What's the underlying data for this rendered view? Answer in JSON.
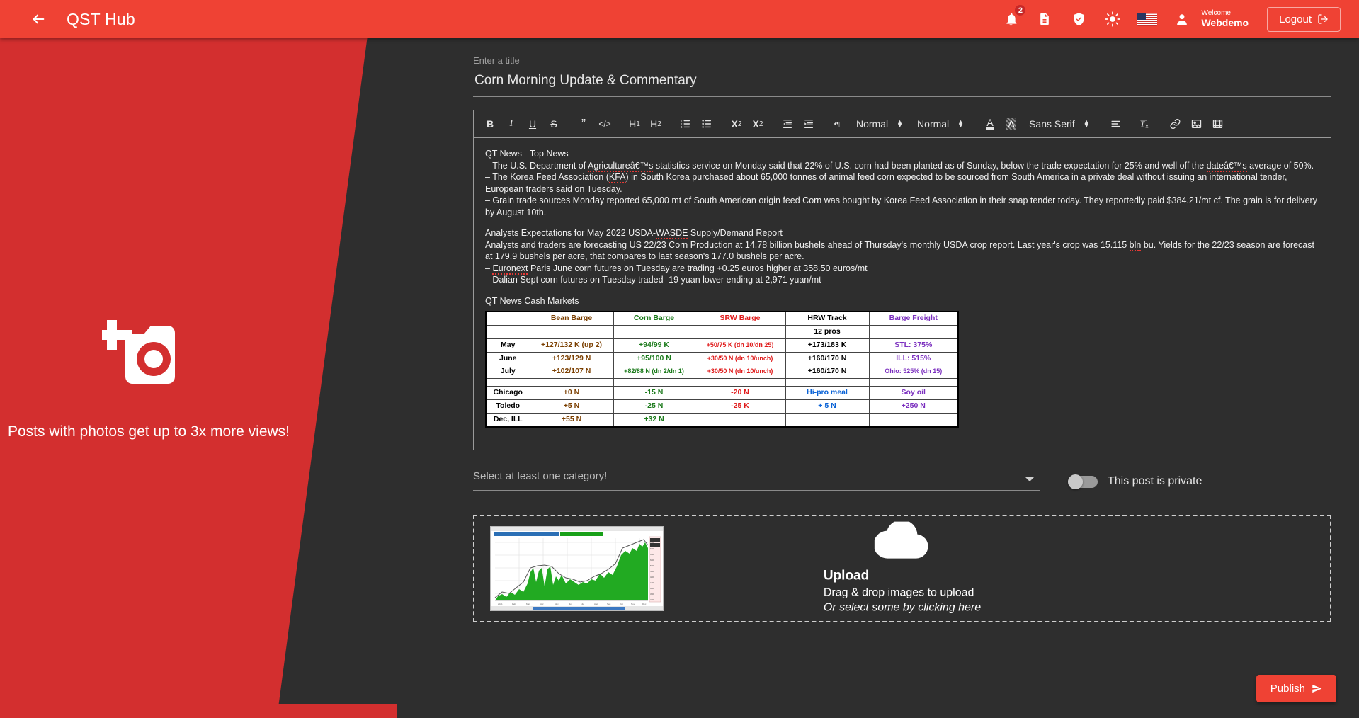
{
  "header": {
    "back_icon": "arrow-left-icon",
    "app_title": "QST Hub",
    "notifications_icon": "bell-icon",
    "notifications_count": "2",
    "documents_icon": "document-icon",
    "shield_icon": "shield-check-icon",
    "theme_icon": "sun-icon",
    "language_icon": "us-flag-icon",
    "avatar_icon": "person-icon",
    "welcome_label": "Welcome",
    "user_name": "Webdemo",
    "logout_label": "Logout",
    "logout_icon": "sign-out-icon",
    "accent_color": "#ef4234"
  },
  "promo": {
    "icon": "add-photo-icon",
    "text": "Posts with photos get up to 3x more views!",
    "background_color": "#d32f2f"
  },
  "compose": {
    "title_label": "Enter a title",
    "title_value": "Corn Morning Update & Commentary",
    "title_placeholder": "Enter a title"
  },
  "toolbar": {
    "bold": "B",
    "italic": "I",
    "underline": "U",
    "strike": "S",
    "blockquote": "”",
    "code_block": "</>",
    "header1": "H",
    "header1_sub": "1",
    "header2": "H",
    "header2_sub": "2",
    "ordered_list": "ordered-list-icon",
    "bullet_list": "bullet-list-icon",
    "subscript": "X",
    "subscript_sub": "2",
    "superscript": "X",
    "superscript_sup": "2",
    "indent_out": "indent-decrease-icon",
    "indent_in": "indent-increase-icon",
    "direction": "text-direction-icon",
    "size_picker": "Normal",
    "header_picker": "Normal",
    "font_color": "A",
    "background_color": "A",
    "font_picker": "Sans Serif",
    "align": "align-icon",
    "clean": "clear-format-icon",
    "link": "link-icon",
    "image": "image-icon",
    "video": "video-icon"
  },
  "body": {
    "h1": "QT News - Top News",
    "p1_pre": "– The U.S. Department of ",
    "p1_spell": "Agricultureâ€™s",
    "p1_post": " statistics service on Monday said that 22% of U.S. corn had been planted as of Sunday, below the trade expectation for 25% and well off the ",
    "p1_spell2": "dateâ€™s",
    "p1_tail": " average of 50%.",
    "p2_pre": "– The Korea Feed Association (",
    "p2_spell": "KFA",
    "p2_post": ") in South Korea purchased about 65,000 tonnes of animal feed corn expected to be sourced from South America in a private deal without issuing an international tender, European traders said on Tuesday.",
    "p3": "– Grain trade sources Monday reported 65,000 mt of South American origin feed Corn was bought by Korea Feed Association in their snap tender today. They reportedly paid $384.21/mt cf. The grain is for delivery by August 10th.",
    "h2_pre": "Analysts Expectations for May 2022 USDA-",
    "h2_spell": "WASDE",
    "h2_post": " Supply/Demand Report",
    "p4_pre": "Analysts and traders are forecasting US 22/23 Corn Production at 14.78 billion bushels ahead of Thursday's monthly USDA crop report. Last year's crop was 15.115 ",
    "p4_spell": "bln",
    "p4_post": " bu. Yields for the 22/23 season are forecast at 179.9 bushels per acre, that compares to last season's 177.0 bushels per acre.",
    "p5_pre": "– ",
    "p5_spell": "Euronext",
    "p5_post": " Paris June corn futures on Tuesday are trading +0.25 euros higher at 358.50 euros/mt",
    "p6": "– Dalian Sept corn futures on Tuesday traded -19 yuan lower ending at 2,971 yuan/mt",
    "h3": "QT News Cash Markets"
  },
  "cash_table": {
    "columns": [
      "",
      "Bean Barge",
      "Corn Barge",
      "SRW Barge",
      "HRW Track",
      "Barge Freight"
    ],
    "subheader": [
      "",
      "",
      "",
      "",
      "12 pros",
      ""
    ],
    "rows": [
      {
        "label": "May",
        "bean": "+127/132 K (up 2)",
        "corn": "+94/99 K",
        "srw": "+50/75 K (dn 10/dn 25)",
        "hrw": "+173/183 K",
        "freight": "STL: 375%"
      },
      {
        "label": "June",
        "bean": "+123/129 N",
        "corn": "+95/100 N",
        "srw": "+30/50 N (dn 10/unch)",
        "hrw": "+160/170 N",
        "freight": "ILL: 515%"
      },
      {
        "label": "July",
        "bean": "+102/107 N",
        "corn": "+82/88 N (dn 2/dn 1)",
        "srw": "+30/50 N (dn 10/unch)",
        "hrw": "+160/170 N",
        "freight": "Ohio: 525% (dn 15)"
      }
    ],
    "rows2": [
      {
        "label": "Chicago",
        "bean": "+0 N",
        "corn": "-15 N",
        "srw": "-20 N",
        "hrw": "Hi-pro meal",
        "freight": "Soy oil"
      },
      {
        "label": "Toledo",
        "bean": "+5 N",
        "corn": "-25 N",
        "srw": "-25 K",
        "hrw": "+ 5 N",
        "freight": "+250 N"
      },
      {
        "label": "Dec, ILL",
        "bean": "+55 N",
        "corn": "+32 N",
        "srw": "",
        "hrw": "",
        "freight": ""
      }
    ],
    "colors": {
      "bean": "#7b3f00",
      "corn": "#1b7a1b",
      "srw": "#e01b1b",
      "hrw": "#000000",
      "freight": "#7b2fbf",
      "blue": "#0b63d6"
    }
  },
  "category": {
    "placeholder": "Select at least one category!",
    "value": "",
    "dropdown_icon": "chevron-down-icon"
  },
  "privacy": {
    "toggle_state": "off",
    "label": "This post is private"
  },
  "upload": {
    "cloud_icon": "cloud-upload-icon",
    "title": "Upload",
    "line1": "Drag & drop images to upload",
    "line2": "Or select some by clicking here",
    "thumbnail_name": "chart-thumbnail"
  },
  "publish": {
    "label": "Publish",
    "icon": "send-icon"
  }
}
